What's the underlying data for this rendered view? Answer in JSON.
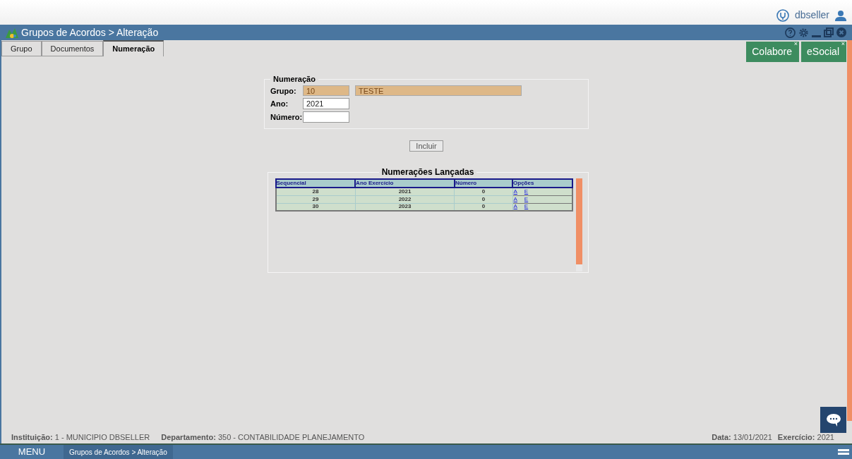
{
  "top_bar": {
    "user": "dbseller"
  },
  "window": {
    "title": "Grupos de Acordos > Alteração"
  },
  "tabs": [
    {
      "label": "Grupo",
      "selected": false
    },
    {
      "label": "Documentos",
      "selected": false
    },
    {
      "label": "Numeração",
      "selected": true
    }
  ],
  "shortcuts": [
    {
      "label": "Colabore",
      "close": "×"
    },
    {
      "label": "eSocial",
      "close": "×"
    }
  ],
  "form": {
    "legend": "Numeração",
    "fields": [
      {
        "label": "Grupo:",
        "value": "10",
        "description": "TESTE",
        "disabled": true
      },
      {
        "label": "Ano:",
        "value": "2021",
        "disabled": false
      },
      {
        "label": "Número:",
        "disabled": false
      }
    ],
    "button": "Incluir"
  },
  "table": {
    "title": "Numerações Lançadas",
    "columns": [
      "Sequencial",
      "Ano Exercício",
      "Número",
      "Opções"
    ],
    "rows": [
      {
        "cells": [
          "28",
          "2021",
          "0"
        ],
        "links": [
          "A",
          "E"
        ]
      },
      {
        "cells": [
          "29",
          "2022",
          "0"
        ],
        "links": [
          "A",
          "E"
        ]
      },
      {
        "cells": [
          "30",
          "2023",
          "0"
        ],
        "links": [
          "A",
          "E"
        ]
      }
    ]
  },
  "status_bar": {
    "left": [
      {
        "label": "Instituição:",
        "value": "1 - MUNICIPIO DBSELLER"
      },
      {
        "label": "Departamento:",
        "value": "350 - CONTABILIDADE PLANEJAMENTO"
      }
    ],
    "right": [
      {
        "label": "Data:",
        "value": "13/01/2021"
      },
      {
        "label": "Exercício:",
        "value": "2021"
      }
    ]
  },
  "taskbar": {
    "menu": "MENU",
    "items": [
      "Grupos de Acordos > Alteração"
    ]
  }
}
